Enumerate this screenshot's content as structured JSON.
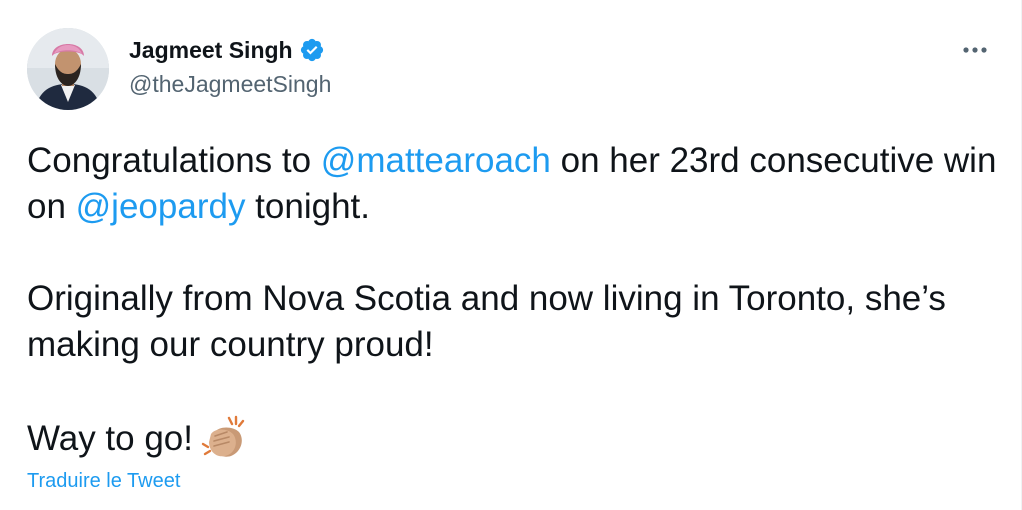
{
  "author": {
    "display_name": "Jagmeet Singh",
    "handle": "@theJagmeetSingh",
    "verified": true
  },
  "tweet": {
    "line1_prefix": "Congratulations to ",
    "mention1": "@mattearoach",
    "line1_suffix": " on her 23rd consecutive win on ",
    "mention2": "@jeopardy",
    "line2_suffix": " tonight.",
    "paragraph2": "Originally from Nova Scotia and now living in Toronto, she’s making our country proud!",
    "paragraph3": "Way to go!",
    "emoji": "clapping-hands-medium-light-skin-tone"
  },
  "actions": {
    "more_icon": "ellipsis-icon",
    "translate_label": "Traduire le Tweet"
  },
  "colors": {
    "text": "#0f1419",
    "secondary": "#536471",
    "link": "#1d9bf0",
    "verified": "#1d9bf0"
  }
}
